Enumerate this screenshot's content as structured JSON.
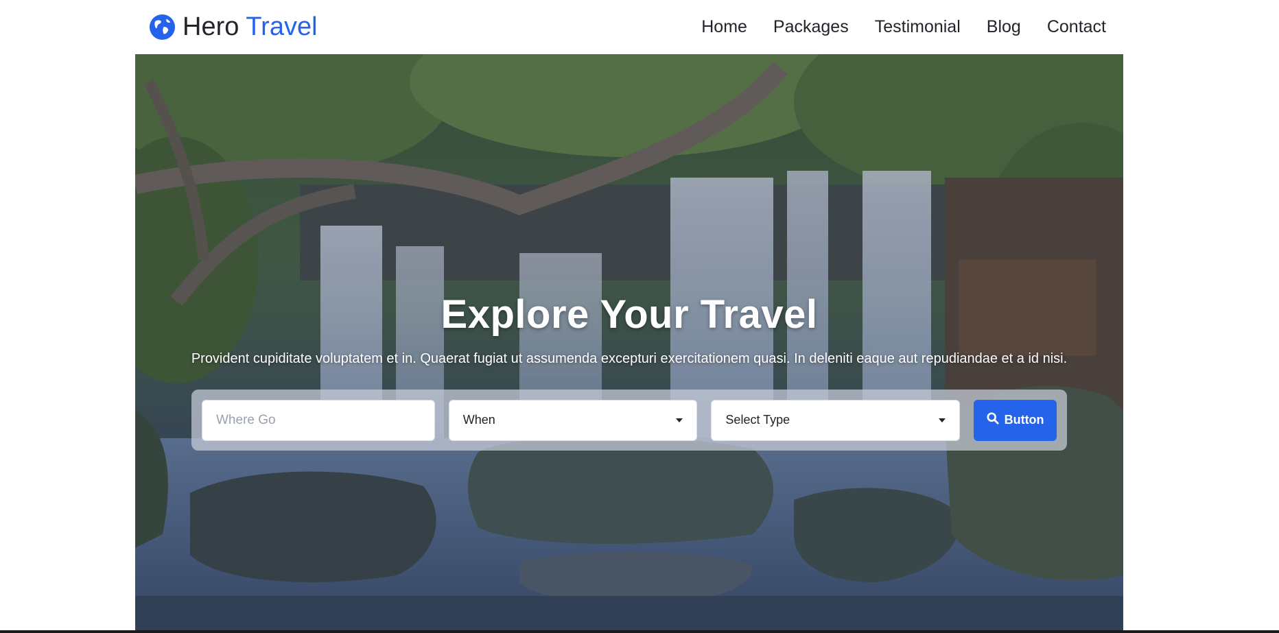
{
  "brand": {
    "name_part1": "Hero",
    "name_part2": "Travel",
    "icon": "globe-icon",
    "accent_color": "#2563eb"
  },
  "nav": {
    "items": [
      "Home",
      "Packages",
      "Testimonial",
      "Blog",
      "Contact"
    ]
  },
  "hero": {
    "title": "Explore Your Travel",
    "subtitle": "Provident cupiditate voluptatem et in. Quaerat fugiat ut assumenda excepturi exercitationem quasi. In deleniti eaque aut repudiandae et a id nisi.",
    "background": "waterfall-forest-photo"
  },
  "search": {
    "where_placeholder": "Where Go",
    "where_value": "",
    "when_value": "When",
    "type_value": "Select Type",
    "button_label": "Button",
    "button_icon": "search-icon",
    "button_color": "#2563eb"
  }
}
